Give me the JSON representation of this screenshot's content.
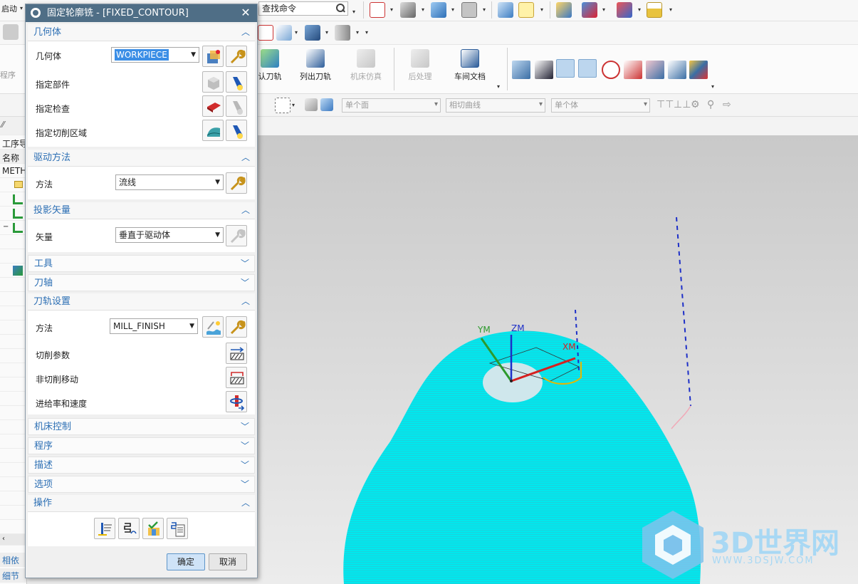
{
  "toolbar": {
    "start_label": "启动",
    "search_placeholder": "查找命令"
  },
  "ribbon": {
    "left_partial_label": "程序",
    "buttons": [
      {
        "label": "认刀轨",
        "enabled": true
      },
      {
        "label": "列出刀轨",
        "enabled": true
      },
      {
        "label": "机床仿真",
        "enabled": false
      },
      {
        "label": "后处理",
        "enabled": false
      },
      {
        "label": "车间文档",
        "enabled": true
      }
    ]
  },
  "filterbar": {
    "face_rule": "单个面",
    "curve_rule": "相切曲线",
    "body_rule": "单个体"
  },
  "navigator": {
    "title_partial": "工序导",
    "col_name": "名称",
    "root_partial": "METH",
    "bottom_tab1": "相依",
    "bottom_tab2": "细节"
  },
  "dialog": {
    "title": "固定轮廓铣 - [FIXED_CONTOUR]",
    "sections": {
      "geometry": {
        "header": "几何体",
        "geometry_label": "几何体",
        "geometry_value": "WORKPIECE",
        "part_label": "指定部件",
        "check_label": "指定检查",
        "cut_area_label": "指定切削区域"
      },
      "drive": {
        "header": "驱动方法",
        "method_label": "方法",
        "method_value": "流线"
      },
      "projection": {
        "header": "投影矢量",
        "vector_label": "矢量",
        "vector_value": "垂直于驱动体"
      },
      "tool": {
        "header": "工具"
      },
      "tool_axis": {
        "header": "刀轴"
      },
      "path_settings": {
        "header": "刀轨设置",
        "method_label": "方法",
        "method_value": "MILL_FINISH",
        "cut_params_label": "切削参数",
        "non_cut_label": "非切削移动",
        "feeds_label": "进给率和速度"
      },
      "machine_control": {
        "header": "机床控制"
      },
      "program": {
        "header": "程序"
      },
      "description": {
        "header": "描述"
      },
      "options": {
        "header": "选项"
      },
      "actions": {
        "header": "操作"
      }
    },
    "ok_label": "确定",
    "cancel_label": "取消"
  },
  "viewport": {
    "axis_y": "YM",
    "axis_z": "ZM",
    "axis_x": "XM",
    "toolpath_color": "#00e8ee"
  },
  "watermark": {
    "brand": "3D世界网",
    "url": "WWW.3DSJW.COM"
  }
}
